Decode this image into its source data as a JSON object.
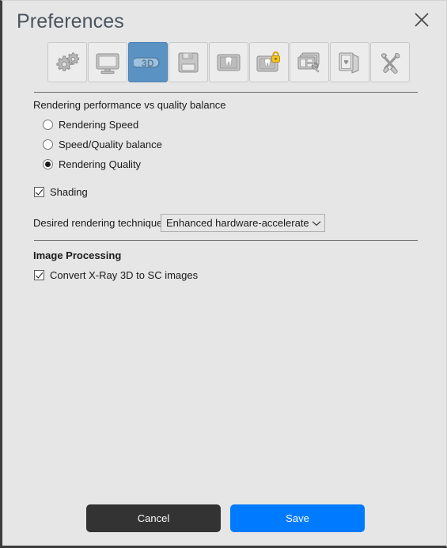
{
  "window": {
    "title": "Preferences",
    "close_icon": "close-icon",
    "bg_color": "#e6e6e6"
  },
  "tabs": [
    {
      "id": "general",
      "icon": "gears-icon",
      "label": "General",
      "selected": false
    },
    {
      "id": "display",
      "icon": "monitor-icon",
      "label": "Display",
      "selected": false
    },
    {
      "id": "3d",
      "icon": "3d-icon",
      "label": "3D",
      "selected": true
    },
    {
      "id": "save",
      "icon": "floppy-disk-icon",
      "label": "Save",
      "selected": false
    },
    {
      "id": "tooth",
      "icon": "tooth-image-icon",
      "label": "Tooth Image",
      "selected": false
    },
    {
      "id": "tooth-locked",
      "icon": "tooth-image-lock-icon",
      "label": "Tooth Image Protection",
      "selected": false
    },
    {
      "id": "layouts",
      "icon": "layouts-wrench-icon",
      "label": "Layouts",
      "selected": false
    },
    {
      "id": "xray",
      "icon": "radiation-pages-icon",
      "label": "X-Ray",
      "selected": false
    },
    {
      "id": "tools",
      "icon": "wrench-screwdriver-icon",
      "label": "Tools",
      "selected": false
    }
  ],
  "selected_tab_color": "#5b92c4",
  "sections": {
    "balance": {
      "label": "Rendering performance vs quality balance",
      "options": [
        {
          "label": "Rendering Speed",
          "selected": false
        },
        {
          "label": "Speed/Quality balance",
          "selected": false
        },
        {
          "label": "Rendering Quality",
          "selected": true
        }
      ],
      "shading": {
        "label": "Shading",
        "checked": true
      },
      "technique": {
        "label": "Desired rendering technique",
        "value": "Enhanced hardware-accelerated ...",
        "caret_icon": "chevron-down-icon"
      }
    },
    "image_processing": {
      "label": "Image Processing",
      "convert": {
        "label": "Convert X-Ray 3D to SC images",
        "checked": true
      }
    }
  },
  "footer": {
    "cancel_label": "Cancel",
    "cancel_color": "#333333",
    "save_label": "Save",
    "save_color": "#007bff"
  }
}
